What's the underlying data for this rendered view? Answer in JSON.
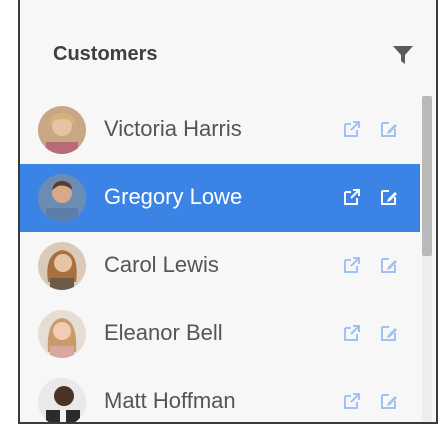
{
  "header": {
    "title": "Customers",
    "filter_icon": "filter-icon"
  },
  "customers": [
    {
      "name": "Victoria Harris",
      "selected": false
    },
    {
      "name": "Gregory Lowe",
      "selected": true
    },
    {
      "name": "Carol Lewis",
      "selected": false
    },
    {
      "name": "Eleanor Bell",
      "selected": false
    },
    {
      "name": "Matt Hoffman",
      "selected": false
    }
  ],
  "row_actions": {
    "open_icon": "open-external-icon",
    "edit_icon": "edit-icon"
  },
  "colors": {
    "selected_row": "#3b84e6",
    "action_icon": "#9ec2f2",
    "action_icon_selected": "#ffffff",
    "title_text": "#3f3f3f",
    "name_text": "#555555"
  }
}
